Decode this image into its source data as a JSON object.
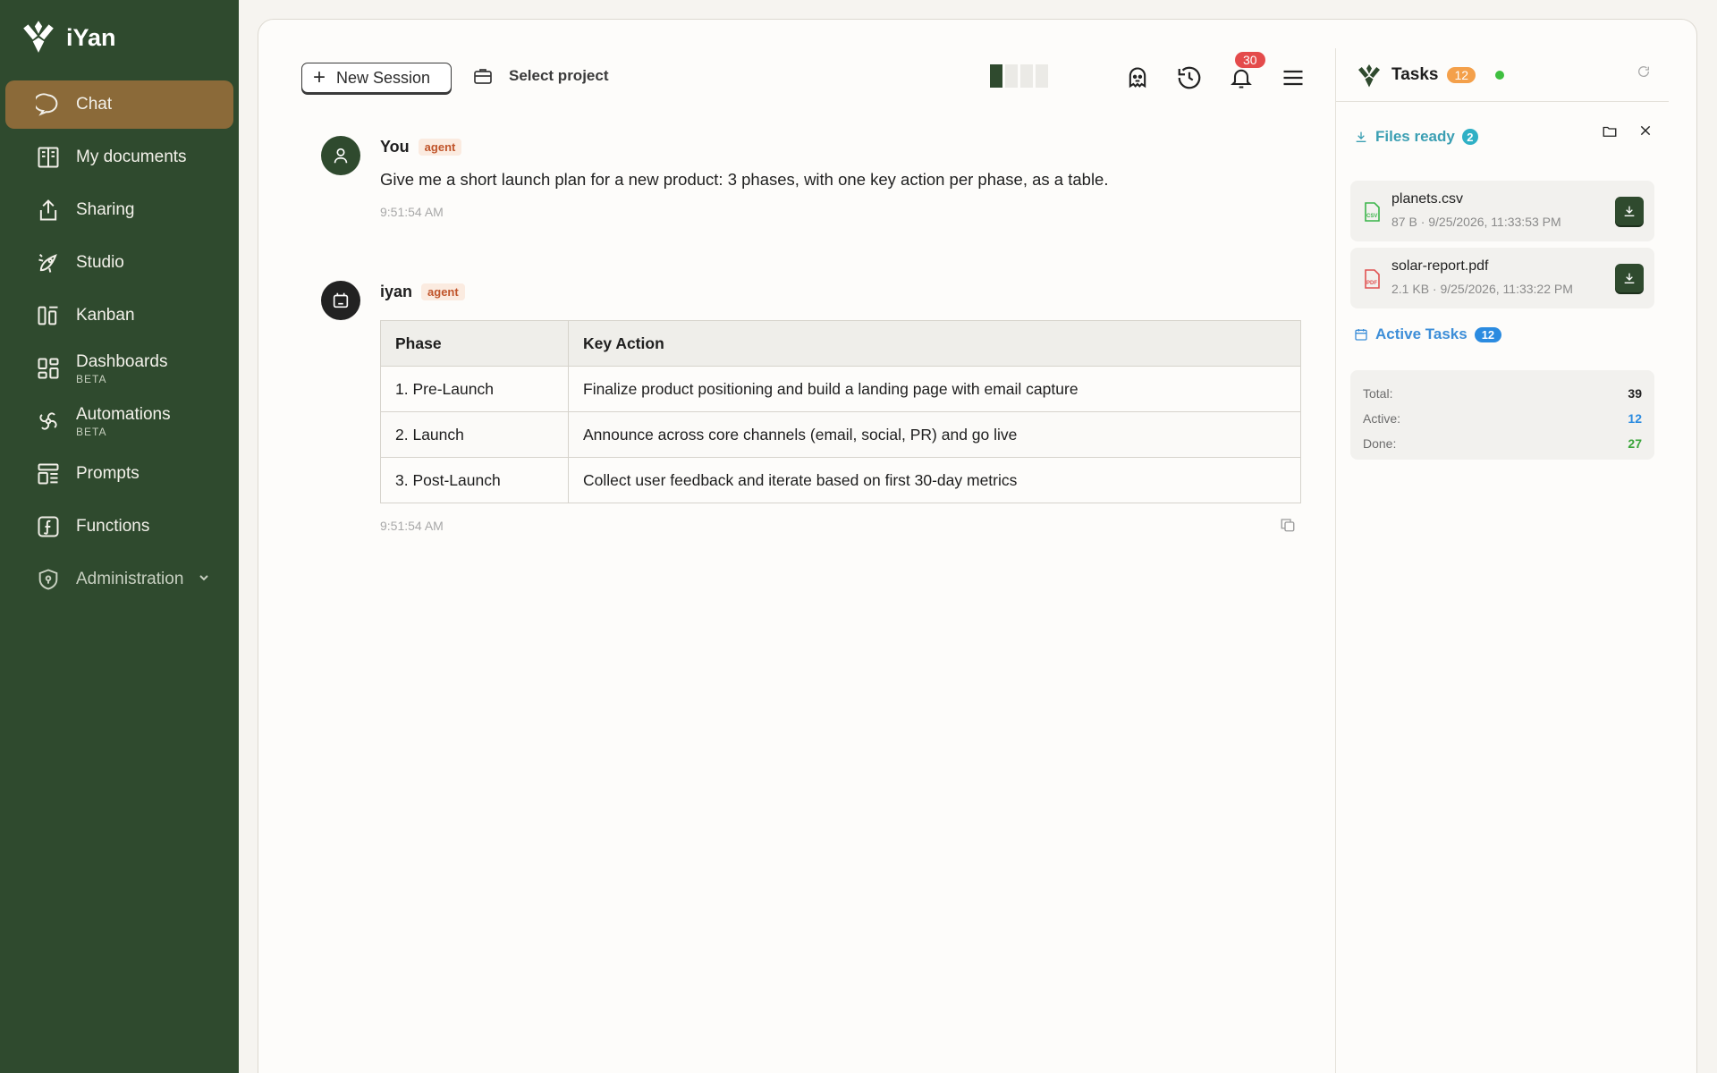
{
  "app": {
    "name": "iYan"
  },
  "sidebar": {
    "items": [
      {
        "label": "Chat",
        "sub": "",
        "icon": "chat-bubble-icon"
      },
      {
        "label": "My documents",
        "sub": "",
        "icon": "book-icon"
      },
      {
        "label": "Sharing",
        "sub": "",
        "icon": "share-icon"
      },
      {
        "label": "Studio",
        "sub": "",
        "icon": "rocket-icon"
      },
      {
        "label": "Kanban",
        "sub": "",
        "icon": "kanban-icon"
      },
      {
        "label": "Dashboards",
        "sub": "BETA",
        "icon": "dashboard-icon"
      },
      {
        "label": "Automations",
        "sub": "BETA",
        "icon": "automation-icon"
      },
      {
        "label": "Prompts",
        "sub": "",
        "icon": "prompt-list-icon"
      },
      {
        "label": "Functions",
        "sub": "",
        "icon": "function-icon"
      },
      {
        "label": "Administration",
        "sub": "",
        "icon": "shield-icon"
      }
    ]
  },
  "toolbar": {
    "new_session": "New Session",
    "select_project": "Select project",
    "notifications_count": "30"
  },
  "messages": {
    "user": {
      "author": "You",
      "tag": "agent",
      "text": "Give me a short launch plan for a new product: 3 phases, with one key action per phase, as a table.",
      "time": "9:51:54 AM"
    },
    "assistant": {
      "author": "iyan",
      "tag": "agent",
      "time": "9:51:54 AM",
      "table": {
        "headers": [
          "Phase",
          "Key Action"
        ],
        "rows": [
          [
            "1. Pre-Launch",
            "Finalize product positioning and build a landing page with email capture"
          ],
          [
            "2. Launch",
            "Announce across core channels (email, social, PR) and go live"
          ],
          [
            "3. Post-Launch",
            "Collect user feedback and iterate based on first 30-day metrics"
          ]
        ]
      }
    }
  },
  "panel": {
    "title": "Tasks",
    "count": "12",
    "files_ready": {
      "label": "Files ready",
      "count": "2"
    },
    "files": [
      {
        "name": "planets.csv",
        "meta": "87 B · 9/25/2026, 11:33:53 PM",
        "icon": "csv-file-icon"
      },
      {
        "name": "solar-report.pdf",
        "meta": "2.1 KB · 9/25/2026, 11:33:22 PM",
        "icon": "pdf-file-icon"
      }
    ],
    "active_tasks": {
      "label": "Active Tasks",
      "count": "12"
    },
    "stats": [
      {
        "label": "Total:",
        "value": "39"
      },
      {
        "label": "Active:",
        "value": "12"
      },
      {
        "label": "Done:",
        "value": "27"
      }
    ]
  },
  "colors": {
    "sidebar": "#2f4a2e",
    "active_nav": "#8b6a39",
    "accent_blue": "#2b8be0"
  }
}
